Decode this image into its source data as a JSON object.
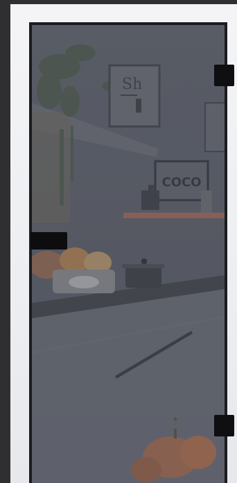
{
  "scene": {
    "description_tags": [
      "glass-door",
      "tinted-glass",
      "kitchen-background"
    ],
    "colors": {
      "frame": "#1b1c20",
      "glass_tint": "#5a5d66",
      "hardware": "#0f0f12",
      "wall": "#f0f1f4",
      "shelf": "#b86a4a"
    },
    "artwork": {
      "frame_text": "Sh",
      "sign_text": "COCO"
    }
  }
}
